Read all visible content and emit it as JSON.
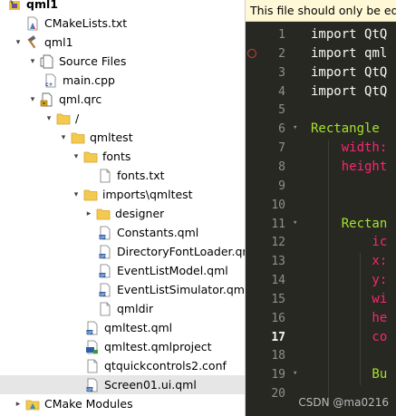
{
  "tree": {
    "rows": [
      {
        "label": "qml1",
        "indent": 8,
        "arrow": "",
        "icon": "project",
        "bold": true
      },
      {
        "label": "CMakeLists.txt",
        "indent": 28,
        "arrow": "",
        "icon": "cmake"
      },
      {
        "label": "qml1",
        "indent": 14,
        "arrow": "▾",
        "icon": "hammer"
      },
      {
        "label": "Source Files",
        "indent": 30,
        "arrow": "▾",
        "icon": "source"
      },
      {
        "label": "main.cpp",
        "indent": 48,
        "arrow": "",
        "icon": "cpp"
      },
      {
        "label": "qml.qrc",
        "indent": 30,
        "arrow": "▾",
        "icon": "qrc"
      },
      {
        "label": "/",
        "indent": 48,
        "arrow": "▾",
        "icon": "folder"
      },
      {
        "label": "qmltest",
        "indent": 64,
        "arrow": "▾",
        "icon": "folder"
      },
      {
        "label": "fonts",
        "indent": 78,
        "arrow": "▾",
        "icon": "folder"
      },
      {
        "label": "fonts.txt",
        "indent": 108,
        "arrow": "",
        "icon": "file"
      },
      {
        "label": "imports\\qmltest",
        "indent": 78,
        "arrow": "▾",
        "icon": "folder"
      },
      {
        "label": "designer",
        "indent": 92,
        "arrow": "▸",
        "icon": "folder"
      },
      {
        "label": "Constants.qml",
        "indent": 108,
        "arrow": "",
        "icon": "qml"
      },
      {
        "label": "DirectoryFontLoader.qml",
        "indent": 108,
        "arrow": "",
        "icon": "qml"
      },
      {
        "label": "EventListModel.qml",
        "indent": 108,
        "arrow": "",
        "icon": "qml"
      },
      {
        "label": "EventListSimulator.qml",
        "indent": 108,
        "arrow": "",
        "icon": "qml"
      },
      {
        "label": "qmldir",
        "indent": 108,
        "arrow": "",
        "icon": "file"
      },
      {
        "label": "qmltest.qml",
        "indent": 94,
        "arrow": "",
        "icon": "qml"
      },
      {
        "label": "qmltest.qmlproject",
        "indent": 94,
        "arrow": "",
        "icon": "qmlproject"
      },
      {
        "label": "qtquickcontrols2.conf",
        "indent": 94,
        "arrow": "",
        "icon": "file"
      },
      {
        "label": "Screen01.ui.qml",
        "indent": 94,
        "arrow": "",
        "icon": "qml",
        "selected": true
      },
      {
        "label": "CMake Modules",
        "indent": 14,
        "arrow": "▸",
        "icon": "cmakemod"
      }
    ]
  },
  "editor": {
    "banner": "This file should only be edited",
    "current_line": 17,
    "lines": [
      {
        "n": "1",
        "fold": "",
        "parts": [
          [
            "kw",
            "import "
          ],
          [
            "kw",
            "QtQ"
          ]
        ]
      },
      {
        "n": "2",
        "fold": "",
        "bp": true,
        "parts": [
          [
            "kw",
            "import "
          ],
          [
            "kw",
            "qml"
          ]
        ]
      },
      {
        "n": "3",
        "fold": "",
        "parts": [
          [
            "kw",
            "import "
          ],
          [
            "kw",
            "QtQ"
          ]
        ]
      },
      {
        "n": "4",
        "fold": "",
        "parts": [
          [
            "kw",
            "import "
          ],
          [
            "kw",
            "QtQ"
          ]
        ]
      },
      {
        "n": "5",
        "fold": "",
        "parts": []
      },
      {
        "n": "6",
        "fold": "▾",
        "parts": [
          [
            "ty",
            "Rectangle "
          ]
        ]
      },
      {
        "n": "7",
        "fold": "",
        "parts": [
          [
            "pr",
            "    width:"
          ]
        ]
      },
      {
        "n": "8",
        "fold": "",
        "parts": [
          [
            "pr",
            "    height"
          ]
        ]
      },
      {
        "n": "9",
        "fold": "",
        "parts": []
      },
      {
        "n": "10",
        "fold": "",
        "parts": []
      },
      {
        "n": "11",
        "fold": "▾",
        "parts": [
          [
            "ty",
            "    Rectan"
          ]
        ]
      },
      {
        "n": "12",
        "fold": "",
        "parts": [
          [
            "pr",
            "        ic"
          ]
        ]
      },
      {
        "n": "13",
        "fold": "",
        "parts": [
          [
            "pr",
            "        x:"
          ]
        ]
      },
      {
        "n": "14",
        "fold": "",
        "parts": [
          [
            "pr",
            "        y:"
          ]
        ]
      },
      {
        "n": "15",
        "fold": "",
        "parts": [
          [
            "pr",
            "        wi"
          ]
        ]
      },
      {
        "n": "16",
        "fold": "",
        "parts": [
          [
            "pr",
            "        he"
          ]
        ]
      },
      {
        "n": "17",
        "fold": "",
        "parts": [
          [
            "pr",
            "        co"
          ]
        ]
      },
      {
        "n": "18",
        "fold": "",
        "parts": []
      },
      {
        "n": "19",
        "fold": "▾",
        "parts": [
          [
            "ty",
            "        Bu"
          ]
        ]
      },
      {
        "n": "20",
        "fold": "",
        "parts": []
      }
    ]
  },
  "watermark": "CSDN @ma0216"
}
